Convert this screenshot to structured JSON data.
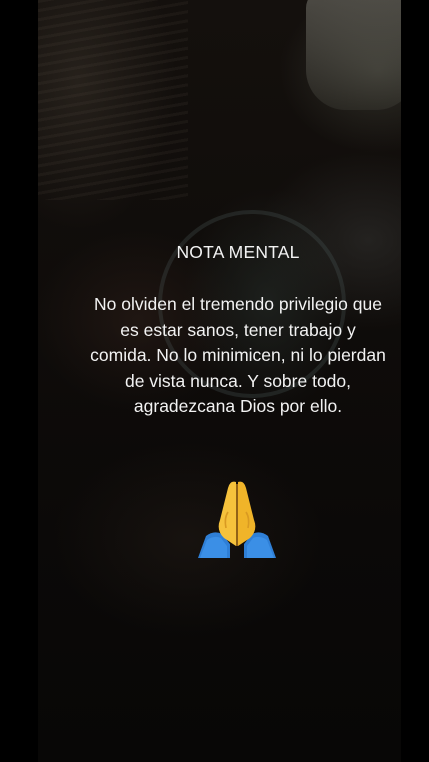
{
  "note": {
    "title": "NOTA MENTAL",
    "body": "No olviden el tremendo privilegio que es estar sanos, tener trabajo y comida. No lo minimicen, ni lo pierdan de vista nunca. Y sobre todo, agradezcana Dios por ello.",
    "emoji": "folded-hands-icon"
  },
  "colors": {
    "background": "#000000",
    "text": "#f2f2f2",
    "emoji_skin": "#f6c23c",
    "emoji_sleeve": "#2f7fd6"
  }
}
